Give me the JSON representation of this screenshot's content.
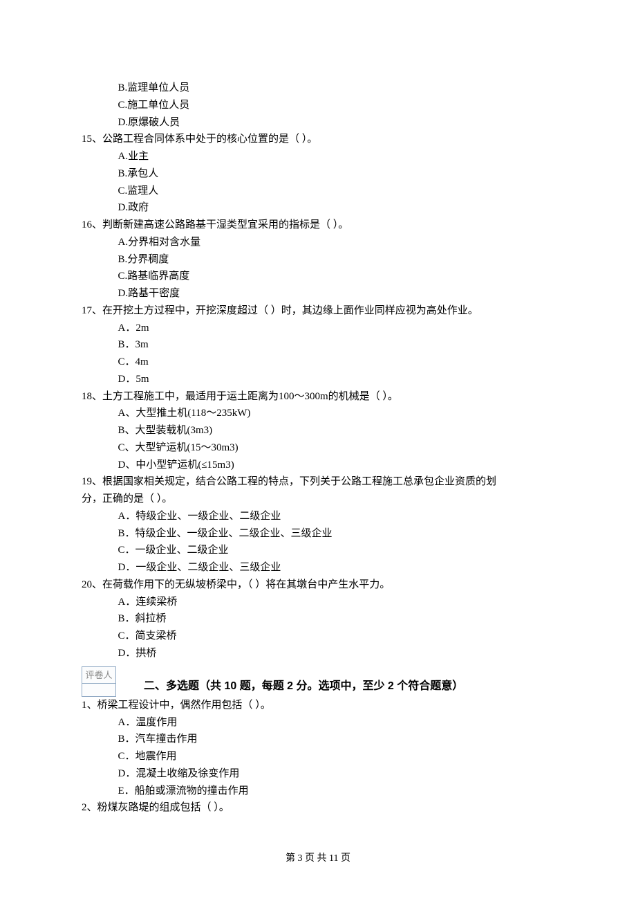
{
  "orphan_opts": {
    "B": "B.监理单位人员",
    "C": "C.施工单位人员",
    "D": "D.原爆破人员"
  },
  "q15": {
    "stem": "15、公路工程合同体系中处于的核心位置的是（    ）。",
    "A": "A.业主",
    "B": "B.承包人",
    "C": "C.监理人",
    "D": "D.政府"
  },
  "q16": {
    "stem": "16、判断新建高速公路路基干湿类型宜采用的指标是（    ）。",
    "A": "A.分界相对含水量",
    "B": "B.分界稠度",
    "C": "C.路基临界高度",
    "D": "D.路基干密度"
  },
  "q17": {
    "stem": "17、在开挖土方过程中，开挖深度超过（    ）时，其边缘上面作业同样应视为高处作业。",
    "A": "A．2m",
    "B": "B．3m",
    "C": "C．4m",
    "D": "D．5m"
  },
  "q18": {
    "stem": "18、土方工程施工中，最适用于运土距离为100～300m的机械是（    ）。",
    "A": "A、大型推土机(118～235kW)",
    "B": "B、大型装载机(3m3)",
    "C": "C、大型铲运机(15～30m3)",
    "D": "D、中小型铲运机(≤15m3)"
  },
  "q19": {
    "stem_l1": "19、根据国家相关规定，结合公路工程的特点，下列关于公路工程施工总承包企业资质的划",
    "stem_l2": "分，正确的是（    ）。",
    "A": "A．特级企业、一级企业、二级企业",
    "B": "B．特级企业、一级企业、二级企业、三级企业",
    "C": "C．一级企业、二级企业",
    "D": "D．一级企业、二级企业、三级企业"
  },
  "q20": {
    "stem": "20、在荷载作用下的无纵坡桥梁中，（    ）将在其墩台中产生水平力。",
    "A": "A．连续梁桥",
    "B": "B．斜拉桥",
    "C": "C．简支梁桥",
    "D": "D．拱桥"
  },
  "grader_label": "评卷人",
  "section2_title": "二、多选题（共 10 题，每题 2 分。选项中，至少 2 个符合题意）",
  "mq1": {
    "stem": "1、桥梁工程设计中，偶然作用包括（    ）。",
    "A": "A．温度作用",
    "B": "B．汽车撞击作用",
    "C": "C．地震作用",
    "D": "D．混凝土收缩及徐变作用",
    "E": "E．船舶或漂流物的撞击作用"
  },
  "mq2": {
    "stem": "2、粉煤灰路堤的组成包括（    ）。"
  },
  "footer": "第 3 页 共 11 页"
}
